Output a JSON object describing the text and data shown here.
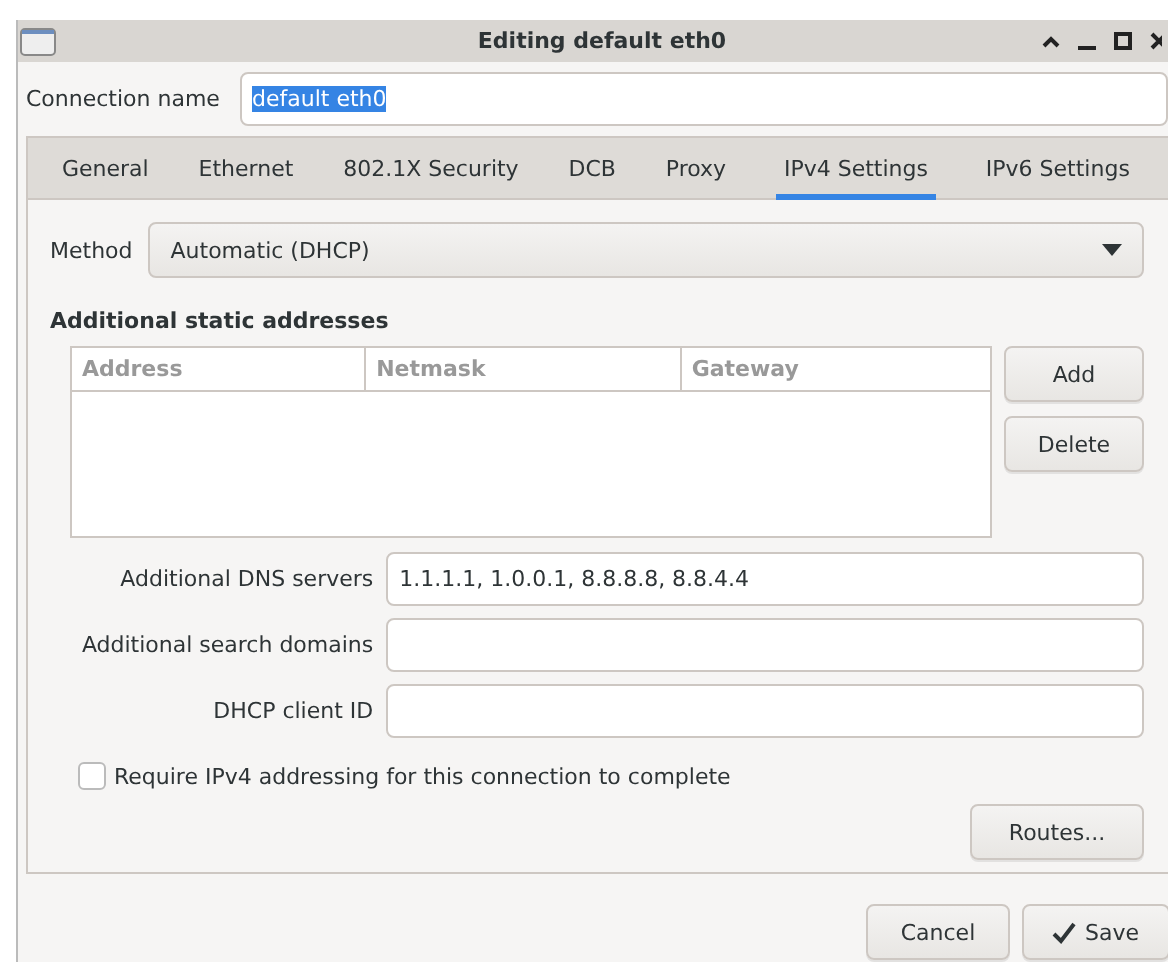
{
  "window": {
    "title": "Editing default eth0"
  },
  "connection_name": {
    "label": "Connection name",
    "value": "default eth0",
    "text_selected": true
  },
  "tabs": [
    {
      "label": "General",
      "selected": false
    },
    {
      "label": "Ethernet",
      "selected": false
    },
    {
      "label": "802.1X Security",
      "selected": false
    },
    {
      "label": "DCB",
      "selected": false
    },
    {
      "label": "Proxy",
      "selected": false
    },
    {
      "label": "IPv4 Settings",
      "selected": true
    },
    {
      "label": "IPv6 Settings",
      "selected": false
    }
  ],
  "method": {
    "label": "Method",
    "value": "Automatic (DHCP)"
  },
  "static_addresses": {
    "title": "Additional static addresses",
    "columns": [
      "Address",
      "Netmask",
      "Gateway"
    ],
    "buttons": [
      "Add",
      "Delete"
    ]
  },
  "fields": [
    {
      "label": "Additional DNS servers",
      "value": "1.1.1.1, 1.0.0.1, 8.8.8.8, 8.8.4.4"
    },
    {
      "label": "Additional search domains"
    },
    {
      "label": "DHCP client ID"
    }
  ],
  "require_ipv4": {
    "label": "Require IPv4 addressing for this connection to complete",
    "checked": false
  },
  "routes_button": "Routes...",
  "buttons": [
    {
      "label": "Cancel",
      "kind": "plain"
    },
    {
      "label": "Save",
      "kind": "confirm"
    }
  ]
}
